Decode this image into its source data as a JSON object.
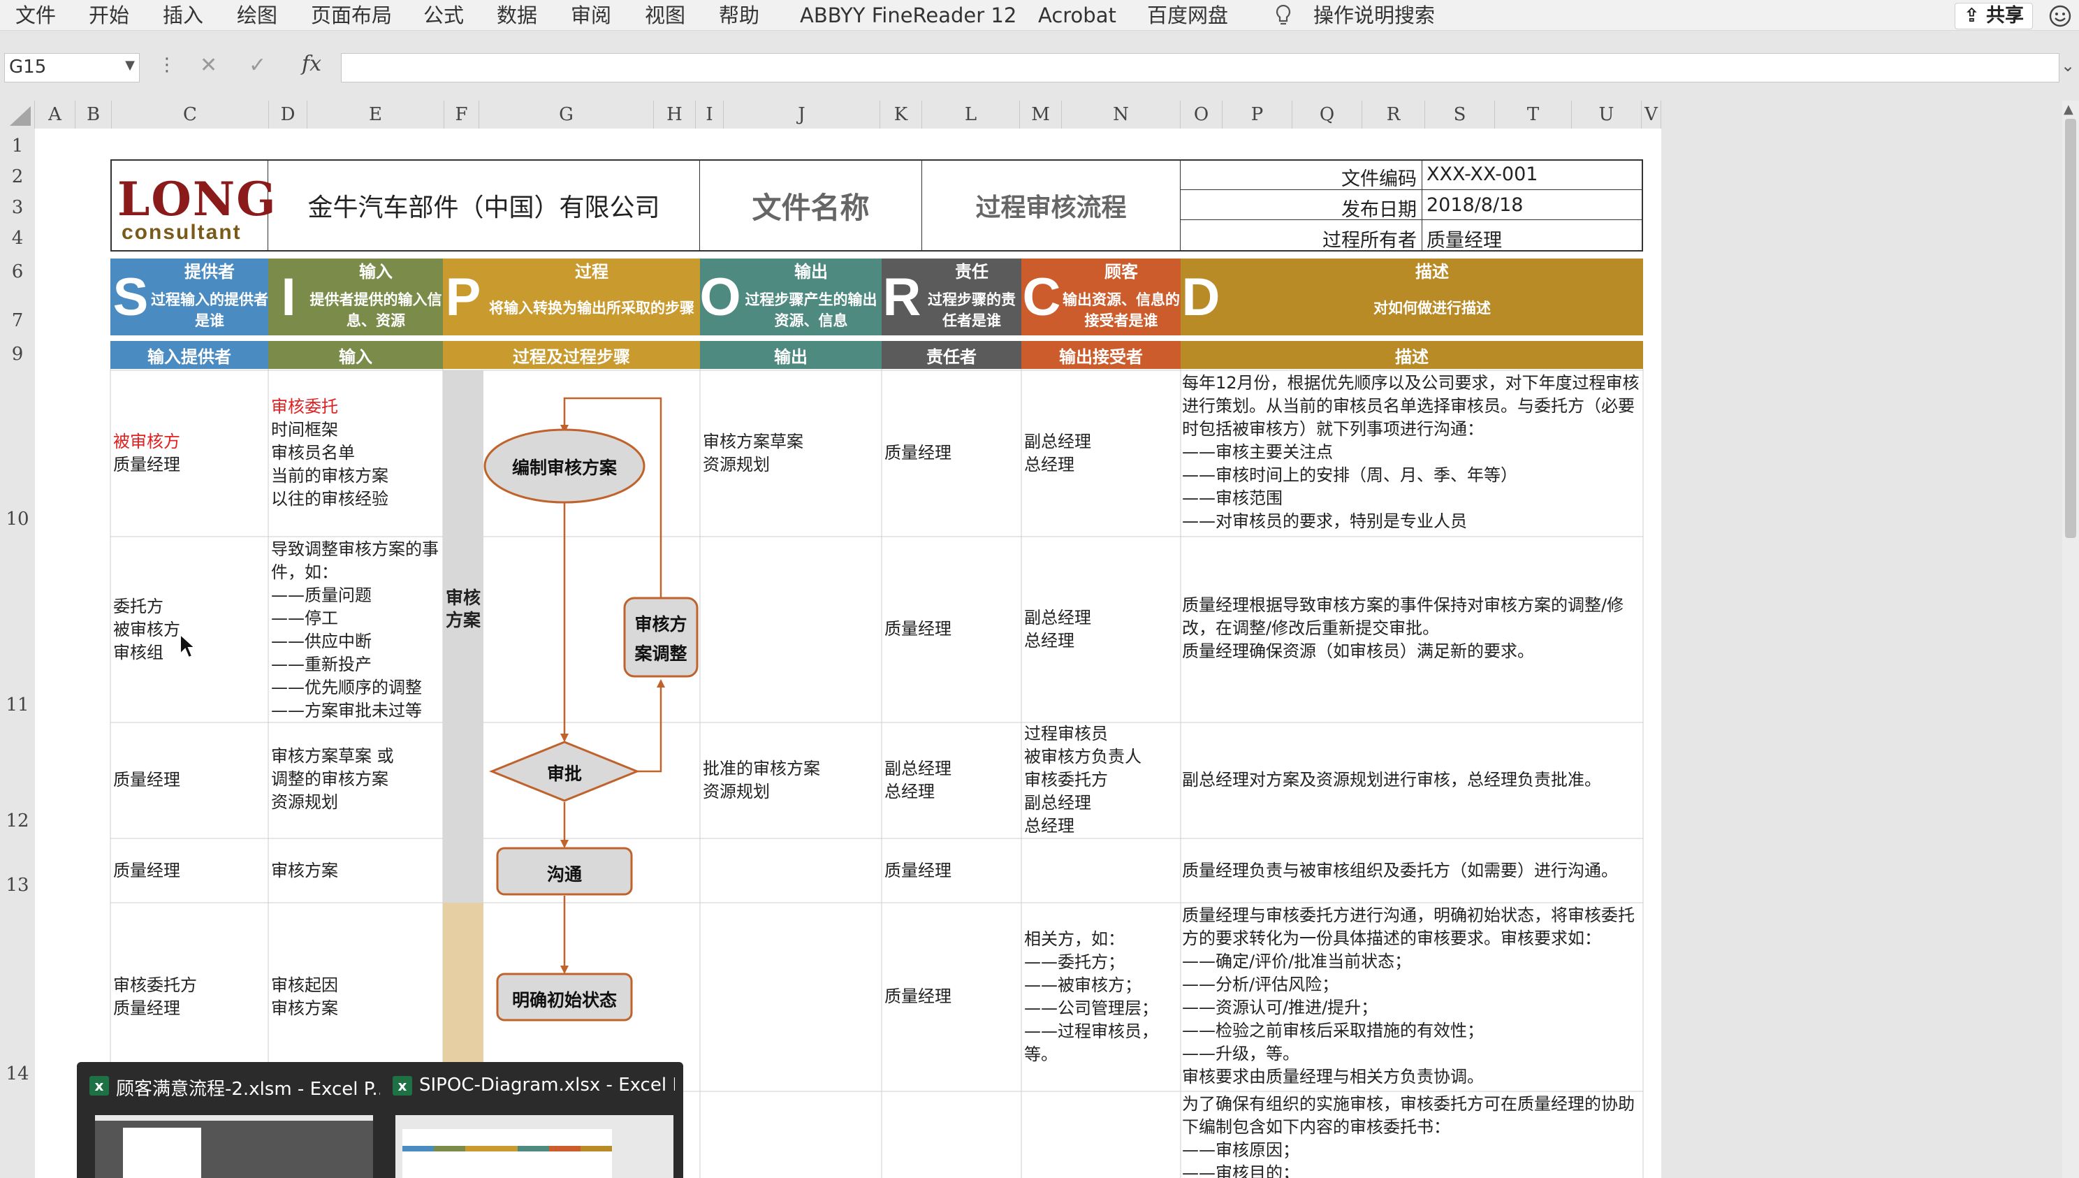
{
  "menu": {
    "items": [
      "文件",
      "开始",
      "插入",
      "绘图",
      "页面布局",
      "公式",
      "数据",
      "审阅",
      "视图",
      "帮助",
      "ABBYY FineReader 12",
      "Acrobat",
      "百度网盘"
    ],
    "tell_me": "操作说明搜索",
    "share": "共享"
  },
  "formula_bar": {
    "name_box": "G15",
    "fx": "fx",
    "content": ""
  },
  "columns": [
    "A",
    "B",
    "C",
    "D",
    "E",
    "F",
    "G",
    "H",
    "I",
    "J",
    "K",
    "L",
    "M",
    "N",
    "O",
    "P",
    "Q",
    "R",
    "S",
    "T",
    "U",
    "V"
  ],
  "rows": [
    "1",
    "2",
    "3",
    "4",
    "6",
    "7",
    "9",
    "10",
    "11",
    "12",
    "13",
    "14"
  ],
  "header": {
    "logo_top": "LONG",
    "logo_bottom": "consultant",
    "company": "金牛汽车部件（中国）有限公司",
    "doc_name_label": "文件名称",
    "doc_name": "过程审核流程",
    "fields": [
      {
        "label": "文件编码",
        "value": "XXX-XX-001"
      },
      {
        "label": "发布日期",
        "value": "2018/8/18"
      },
      {
        "label": "过程所有者",
        "value": "质量经理"
      }
    ]
  },
  "sipoc": [
    {
      "letter": "S",
      "title": "提供者",
      "desc": "过程输入的提供者是谁",
      "color": "#4a8bc2"
    },
    {
      "letter": "I",
      "title": "输入",
      "desc": "提供者提供的输入信息、资源",
      "color": "#7b8c4a"
    },
    {
      "letter": "P",
      "title": "过程",
      "desc": "将输入转换为输出所采取的步骤",
      "color": "#c99a2e"
    },
    {
      "letter": "O",
      "title": "输出",
      "desc": "过程步骤产生的输出资源、信息",
      "color": "#4e8a80"
    },
    {
      "letter": "R",
      "title": "责任",
      "desc": "过程步骤的责任者是谁",
      "color": "#5b5b5b"
    },
    {
      "letter": "C",
      "title": "顾客",
      "desc": "输出资源、信息的接受者是谁",
      "color": "#cd5c2c"
    },
    {
      "letter": "D",
      "title": "描述",
      "desc": "对如何做进行描述",
      "color": "#b88b27"
    }
  ],
  "colheaders": [
    "输入提供者",
    "输入",
    "过程及过程步骤",
    "输出",
    "责任者",
    "输出接受者",
    "描述"
  ],
  "phase_label": "审核方案",
  "flow": {
    "s1": "编制审核方案",
    "s2a": "审核方",
    "s2b": "案调整",
    "s3": "审批",
    "s4": "沟通",
    "s5": "明确初始状态"
  },
  "table_rows": [
    {
      "supplier_red": "被审核方",
      "supplier": "质量经理",
      "input_red": "审核委托",
      "input": "时间框架\n审核员名单\n当前的审核方案\n以往的审核经验",
      "output": "审核方案草案\n资源规划",
      "owner": "质量经理",
      "customer": "副总经理\n总经理",
      "desc": "每年12月份，根据优先顺序以及公司要求，对下年度过程审核进行策划。从当前的审核员名单选择审核员。与委托方（必要时包括被审核方）就下列事项进行沟通：\n——审核主要关注点\n——审核时间上的安排（周、月、季、年等）\n——审核范围\n——对审核员的要求，特别是专业人员"
    },
    {
      "supplier_red": "",
      "supplier": "委托方\n被审核方\n审核组",
      "input_red": "",
      "input": "导致调整审核方案的事件，如：\n——质量问题\n——停工\n——供应中断\n——重新投产\n——优先顺序的调整\n——方案审批未过等",
      "output": "",
      "owner": "质量经理",
      "customer": "副总经理\n总经理",
      "desc": "质量经理根据导致审核方案的事件保持对审核方案的调整/修改，在调整/修改后重新提交审批。\n质量经理确保资源（如审核员）满足新的要求。"
    },
    {
      "supplier_red": "",
      "supplier": "质量经理",
      "input_red": "",
      "input": "审核方案草案 或\n调整的审核方案\n资源规划",
      "output": "批准的审核方案\n资源规划",
      "owner": "副总经理\n总经理",
      "customer": "过程审核员\n被审核方负责人\n审核委托方\n副总经理\n总经理",
      "desc": "副总经理对方案及资源规划进行审核，总经理负责批准。"
    },
    {
      "supplier_red": "",
      "supplier": "质量经理",
      "input_red": "",
      "input": "审核方案",
      "output": "",
      "owner": "质量经理",
      "customer": "",
      "desc": "质量经理负责与被审核组织及委托方（如需要）进行沟通。"
    },
    {
      "supplier_red": "",
      "supplier": "审核委托方\n质量经理",
      "input_red": "",
      "input": "审核起因\n审核方案",
      "output": "",
      "owner": "质量经理",
      "customer": "相关方，如：\n——委托方；\n——被审核方；\n——公司管理层；\n——过程审核员，\n等。",
      "desc": "质量经理与审核委托方进行沟通，明确初始状态，将审核委托方的要求转化为一份具体描述的审核要求。审核要求如：\n——确定/评价/批准当前状态；\n——分析/评估风险；\n——资源认可/推进/提升；\n——检验之前审核后采取措施的有效性；\n——升级，等。\n审核要求由质量经理与相关方负责协调。"
    },
    {
      "supplier_red": "",
      "supplier": "",
      "input_red": "",
      "input": "",
      "output": "",
      "owner": "",
      "customer": "",
      "desc": "为了确保有组织的实施审核，审核委托方可在质量经理的协助下编制包含如下内容的审核委托书：\n——审核原因；\n——审核目的；"
    }
  ],
  "taskbar": [
    {
      "title": "顾客满意流程-2.xlsm - Excel P..."
    },
    {
      "title": "SIPOC-Diagram.xlsx - Excel P..."
    }
  ]
}
